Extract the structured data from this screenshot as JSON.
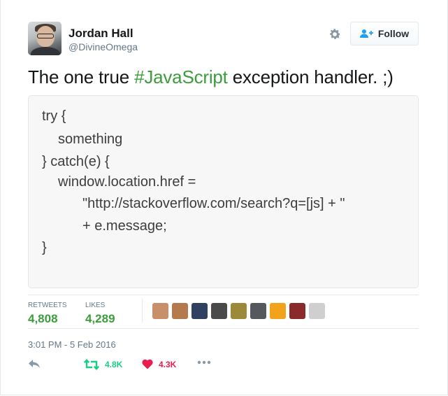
{
  "author": {
    "name": "Jordan Hall",
    "handle": "@DivineOmega"
  },
  "follow_button": {
    "label": "Follow"
  },
  "tweet": {
    "text_before": "The one true ",
    "hashtag": "#JavaScript",
    "text_after": " exception handler. ;)"
  },
  "code_image": {
    "lines": [
      "try {",
      "something",
      "} catch(e) {",
      "window.location.href =",
      "\"http://stackoverflow.com/search?q=[js] + \"",
      "+ e.message;",
      "}"
    ]
  },
  "stats": {
    "retweets_label": "RETWEETS",
    "retweets_value": "4,808",
    "likes_label": "LIKES",
    "likes_value": "4,289"
  },
  "likers": [
    {
      "icon": "user-avatar-1",
      "color": "#c98f6a"
    },
    {
      "icon": "user-avatar-2",
      "color": "#b57a4c"
    },
    {
      "icon": "user-avatar-3",
      "color": "#2f4060"
    },
    {
      "icon": "user-avatar-4",
      "color": "#4a4a4a"
    },
    {
      "icon": "user-avatar-5",
      "color": "#9c8a3a"
    },
    {
      "icon": "user-avatar-6",
      "color": "#55585c"
    },
    {
      "icon": "user-avatar-7",
      "color": "#f2a21b"
    },
    {
      "icon": "user-avatar-8",
      "color": "#8a2a2a"
    },
    {
      "icon": "user-avatar-9",
      "color": "#cfcfcf"
    }
  ],
  "timestamp": "3:01 PM - 5 Feb 2016",
  "actions": {
    "reply_icon": "reply-icon",
    "retweet_count": "4.8K",
    "like_count": "4.3K",
    "more_icon": "more-icon"
  },
  "colors": {
    "accent_green": "#3b9d3b",
    "retweet_green": "#19cf86",
    "like_red": "#e81c4f",
    "muted": "#657786"
  }
}
